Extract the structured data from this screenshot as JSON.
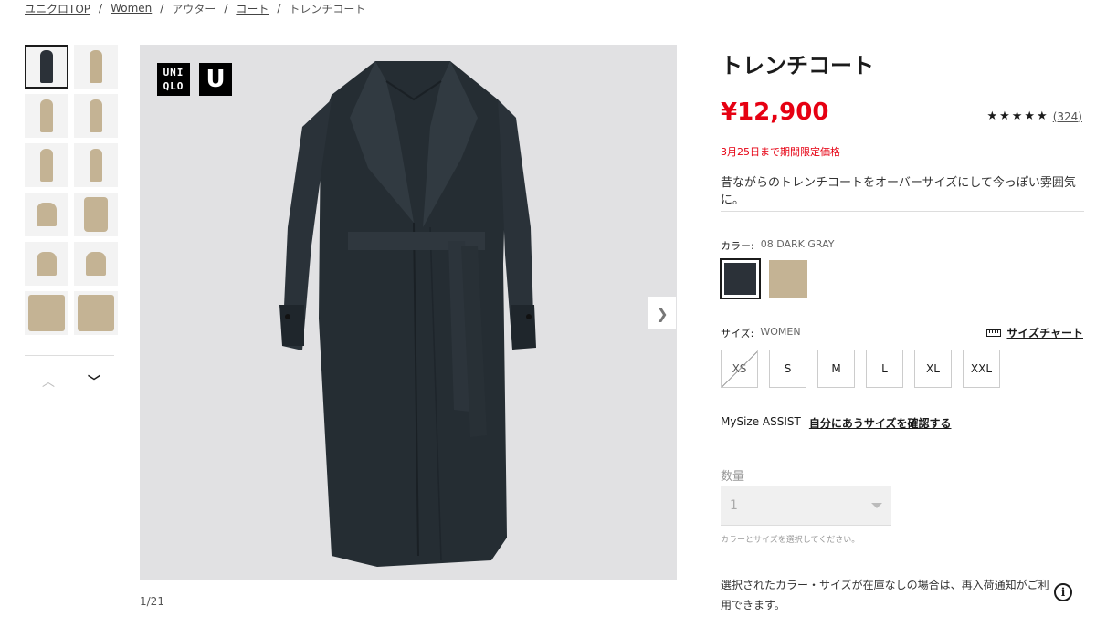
{
  "breadcrumb": {
    "items": [
      "ユニクロTOP",
      "Women",
      "アウター",
      "コート",
      "トレンチコート"
    ],
    "separator": "/"
  },
  "gallery": {
    "logo_uniqlo": [
      "UNI",
      "QLO"
    ],
    "logo_u": "U",
    "counter": "1/21",
    "thumb_colors": [
      "#2b3138",
      "#c2b08f",
      "#c4b394",
      "#c4b394",
      "#c4b394",
      "#c4b394",
      "#c4b394",
      "#c4b394",
      "#c4b394",
      "#c4b394",
      "#c4b394",
      "#c4b394"
    ]
  },
  "product": {
    "title": "トレンチコート",
    "price": "¥12,900",
    "rating_stars": "★★★★★",
    "rating_value": 4.5,
    "review_count": "(324)",
    "promo": "3月25日まで期間限定価格",
    "description": "昔ながらのトレンチコートをオーバーサイズにして今っぽい雰囲気に。"
  },
  "color": {
    "label": "カラー:",
    "value": "08 DARK GRAY",
    "swatches": [
      "#2b3138",
      "#c4b394"
    ]
  },
  "size": {
    "label": "サイズ:",
    "value": "WOMEN",
    "chart_label": "サイズチャート",
    "options": [
      "XS",
      "S",
      "M",
      "L",
      "XL",
      "XXL"
    ],
    "unavailable": [
      "XS"
    ]
  },
  "mysize": {
    "label": "MySize ASSIST",
    "link": "自分にあうサイズを確認する"
  },
  "quantity": {
    "label": "数量",
    "value": "1",
    "hint": "カラーとサイズを選択してください。"
  },
  "notice": "選択されたカラー・サイズが在庫なしの場合は、再入荷通知がご利用できます。",
  "info_icon": "i"
}
